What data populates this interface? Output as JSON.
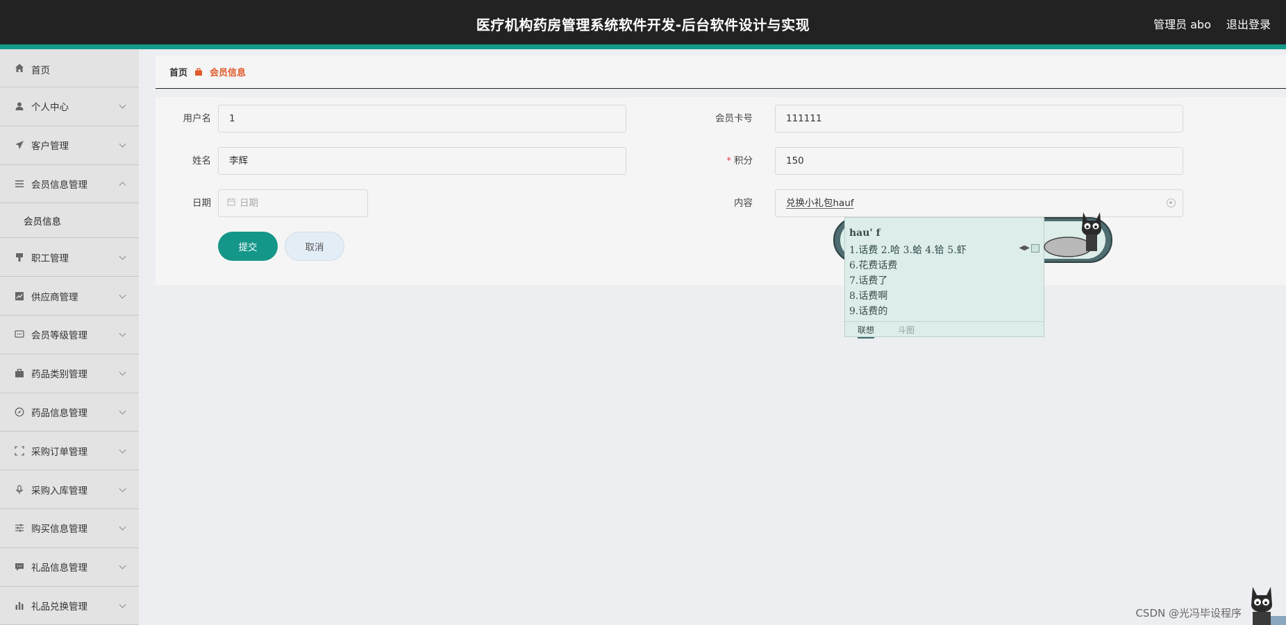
{
  "header": {
    "title": "医疗机构药房管理系统软件开发-后台软件设计与实现",
    "user": "管理员 abo",
    "logout": "退出登录"
  },
  "sidebar": {
    "items": [
      {
        "label": "首页",
        "icon": "home-icon"
      },
      {
        "label": "个人中心",
        "icon": "user-icon"
      },
      {
        "label": "客户管理",
        "icon": "send-icon"
      },
      {
        "label": "会员信息管理",
        "icon": "list-icon",
        "expanded": true
      },
      {
        "label": "职工管理",
        "icon": "stamp-icon"
      },
      {
        "label": "供应商管理",
        "icon": "chart-line-icon"
      },
      {
        "label": "会员等级管理",
        "icon": "chat-icon"
      },
      {
        "label": "药品类别管理",
        "icon": "briefcase-icon"
      },
      {
        "label": "药品信息管理",
        "icon": "compass-icon"
      },
      {
        "label": "采购订单管理",
        "icon": "scan-icon"
      },
      {
        "label": "采购入库管理",
        "icon": "mic-icon"
      },
      {
        "label": "购买信息管理",
        "icon": "sliders-icon"
      },
      {
        "label": "礼品信息管理",
        "icon": "message-icon"
      },
      {
        "label": "礼品兑换管理",
        "icon": "bar-chart-icon"
      }
    ],
    "submenu": {
      "label": "会员信息"
    }
  },
  "breadcrumb": {
    "home": "首页",
    "current": "会员信息"
  },
  "form": {
    "username": {
      "label": "用户名",
      "value": "1"
    },
    "card_no": {
      "label": "会员卡号",
      "value": "111111"
    },
    "name": {
      "label": "姓名",
      "value": "李辉"
    },
    "points": {
      "label": "积分",
      "value": "150",
      "required_mark": "*"
    },
    "date": {
      "label": "日期",
      "placeholder": "日期"
    },
    "content": {
      "label": "内容",
      "value": "兑换小礼包hauf"
    },
    "submit": "提交",
    "cancel": "取消"
  },
  "ime": {
    "composition": "hau' f",
    "candidates_line1": "1.话费  2.哈  3.蛤  4.铪  5.虾",
    "candidates": [
      "6.花费话费",
      "7.话费了",
      "8.话费啊",
      "9.话费的"
    ],
    "tab_active": "联想",
    "tab_inactive": "斗图"
  },
  "watermark": "CSDN @光冯毕设程序"
}
